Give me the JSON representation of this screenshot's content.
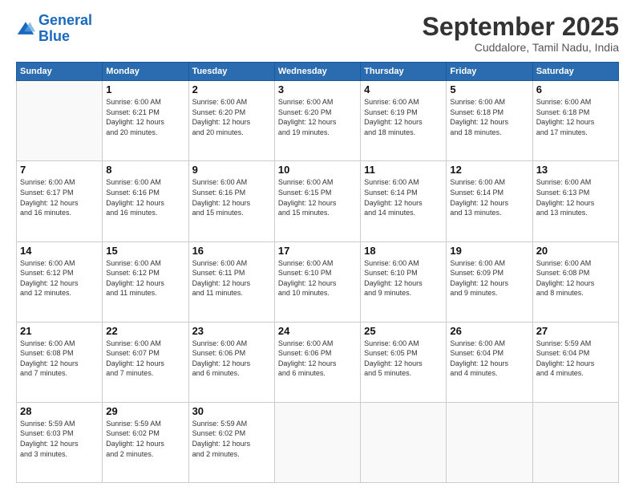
{
  "logo": {
    "line1": "General",
    "line2": "Blue"
  },
  "title": "September 2025",
  "subtitle": "Cuddalore, Tamil Nadu, India",
  "weekdays": [
    "Sunday",
    "Monday",
    "Tuesday",
    "Wednesday",
    "Thursday",
    "Friday",
    "Saturday"
  ],
  "weeks": [
    [
      {
        "day": "",
        "info": ""
      },
      {
        "day": "1",
        "info": "Sunrise: 6:00 AM\nSunset: 6:21 PM\nDaylight: 12 hours\nand 20 minutes."
      },
      {
        "day": "2",
        "info": "Sunrise: 6:00 AM\nSunset: 6:20 PM\nDaylight: 12 hours\nand 20 minutes."
      },
      {
        "day": "3",
        "info": "Sunrise: 6:00 AM\nSunset: 6:20 PM\nDaylight: 12 hours\nand 19 minutes."
      },
      {
        "day": "4",
        "info": "Sunrise: 6:00 AM\nSunset: 6:19 PM\nDaylight: 12 hours\nand 18 minutes."
      },
      {
        "day": "5",
        "info": "Sunrise: 6:00 AM\nSunset: 6:18 PM\nDaylight: 12 hours\nand 18 minutes."
      },
      {
        "day": "6",
        "info": "Sunrise: 6:00 AM\nSunset: 6:18 PM\nDaylight: 12 hours\nand 17 minutes."
      }
    ],
    [
      {
        "day": "7",
        "info": "Sunrise: 6:00 AM\nSunset: 6:17 PM\nDaylight: 12 hours\nand 16 minutes."
      },
      {
        "day": "8",
        "info": "Sunrise: 6:00 AM\nSunset: 6:16 PM\nDaylight: 12 hours\nand 16 minutes."
      },
      {
        "day": "9",
        "info": "Sunrise: 6:00 AM\nSunset: 6:16 PM\nDaylight: 12 hours\nand 15 minutes."
      },
      {
        "day": "10",
        "info": "Sunrise: 6:00 AM\nSunset: 6:15 PM\nDaylight: 12 hours\nand 15 minutes."
      },
      {
        "day": "11",
        "info": "Sunrise: 6:00 AM\nSunset: 6:14 PM\nDaylight: 12 hours\nand 14 minutes."
      },
      {
        "day": "12",
        "info": "Sunrise: 6:00 AM\nSunset: 6:14 PM\nDaylight: 12 hours\nand 13 minutes."
      },
      {
        "day": "13",
        "info": "Sunrise: 6:00 AM\nSunset: 6:13 PM\nDaylight: 12 hours\nand 13 minutes."
      }
    ],
    [
      {
        "day": "14",
        "info": "Sunrise: 6:00 AM\nSunset: 6:12 PM\nDaylight: 12 hours\nand 12 minutes."
      },
      {
        "day": "15",
        "info": "Sunrise: 6:00 AM\nSunset: 6:12 PM\nDaylight: 12 hours\nand 11 minutes."
      },
      {
        "day": "16",
        "info": "Sunrise: 6:00 AM\nSunset: 6:11 PM\nDaylight: 12 hours\nand 11 minutes."
      },
      {
        "day": "17",
        "info": "Sunrise: 6:00 AM\nSunset: 6:10 PM\nDaylight: 12 hours\nand 10 minutes."
      },
      {
        "day": "18",
        "info": "Sunrise: 6:00 AM\nSunset: 6:10 PM\nDaylight: 12 hours\nand 9 minutes."
      },
      {
        "day": "19",
        "info": "Sunrise: 6:00 AM\nSunset: 6:09 PM\nDaylight: 12 hours\nand 9 minutes."
      },
      {
        "day": "20",
        "info": "Sunrise: 6:00 AM\nSunset: 6:08 PM\nDaylight: 12 hours\nand 8 minutes."
      }
    ],
    [
      {
        "day": "21",
        "info": "Sunrise: 6:00 AM\nSunset: 6:08 PM\nDaylight: 12 hours\nand 7 minutes."
      },
      {
        "day": "22",
        "info": "Sunrise: 6:00 AM\nSunset: 6:07 PM\nDaylight: 12 hours\nand 7 minutes."
      },
      {
        "day": "23",
        "info": "Sunrise: 6:00 AM\nSunset: 6:06 PM\nDaylight: 12 hours\nand 6 minutes."
      },
      {
        "day": "24",
        "info": "Sunrise: 6:00 AM\nSunset: 6:06 PM\nDaylight: 12 hours\nand 6 minutes."
      },
      {
        "day": "25",
        "info": "Sunrise: 6:00 AM\nSunset: 6:05 PM\nDaylight: 12 hours\nand 5 minutes."
      },
      {
        "day": "26",
        "info": "Sunrise: 6:00 AM\nSunset: 6:04 PM\nDaylight: 12 hours\nand 4 minutes."
      },
      {
        "day": "27",
        "info": "Sunrise: 5:59 AM\nSunset: 6:04 PM\nDaylight: 12 hours\nand 4 minutes."
      }
    ],
    [
      {
        "day": "28",
        "info": "Sunrise: 5:59 AM\nSunset: 6:03 PM\nDaylight: 12 hours\nand 3 minutes."
      },
      {
        "day": "29",
        "info": "Sunrise: 5:59 AM\nSunset: 6:02 PM\nDaylight: 12 hours\nand 2 minutes."
      },
      {
        "day": "30",
        "info": "Sunrise: 5:59 AM\nSunset: 6:02 PM\nDaylight: 12 hours\nand 2 minutes."
      },
      {
        "day": "",
        "info": ""
      },
      {
        "day": "",
        "info": ""
      },
      {
        "day": "",
        "info": ""
      },
      {
        "day": "",
        "info": ""
      }
    ]
  ]
}
